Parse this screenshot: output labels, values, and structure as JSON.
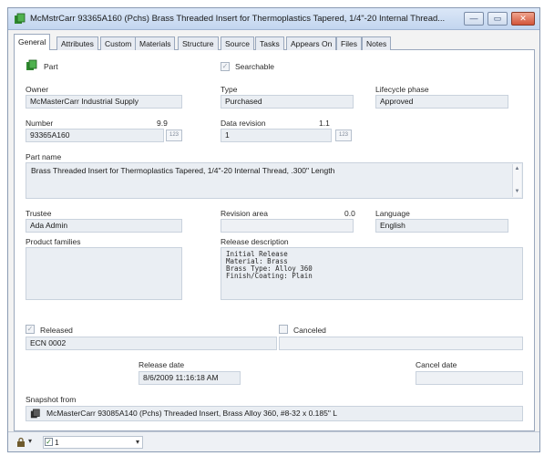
{
  "window": {
    "title": "McMstrCarr 93365A160 (Pchs) Brass Threaded Insert for Thermoplastics Tapered, 1/4\"-20 Internal Thread..."
  },
  "tabs": [
    "General",
    "Attributes",
    "Custom",
    "Materials",
    "Structure",
    "Source",
    "Tasks",
    "Appears On",
    "Files",
    "Notes"
  ],
  "header": {
    "part_label": "Part",
    "searchable_label": "Searchable"
  },
  "fields": {
    "owner_label": "Owner",
    "owner_value": "McMasterCarr Industrial Supply",
    "type_label": "Type",
    "type_value": "Purchased",
    "lifecycle_label": "Lifecycle phase",
    "lifecycle_value": "Approved",
    "number_label": "Number",
    "number_version": "9.9",
    "number_value": "93365A160",
    "datarev_label": "Data revision",
    "datarev_version": "1.1",
    "datarev_value": "1",
    "partname_label": "Part name",
    "partname_value": "Brass Threaded Insert for Thermoplastics Tapered, 1/4\"-20 Internal Thread, .300\" Length",
    "trustee_label": "Trustee",
    "trustee_value": "Ada Admin",
    "revarea_label": "Revision area",
    "revarea_version": "0.0",
    "language_label": "Language",
    "language_value": "English",
    "prodfam_label": "Product families",
    "reldesc_label": "Release description",
    "reldesc_lines": [
      "Initial Release",
      "Material: Brass",
      "Brass Type: Alloy 360",
      "Finish/Coating: Plain"
    ],
    "released_label": "Released",
    "released_value": "ECN 0002",
    "canceled_label": "Canceled",
    "reldate_label": "Release date",
    "reldate_value": "8/6/2009 11:16:18 AM",
    "canceldate_label": "Cancel date",
    "snapshot_label": "Snapshot from",
    "snapshot_value": "McMasterCarr 93085A140 (Pchs) Threaded Insert, Brass Alloy 360, #8-32 x 0.185\" L"
  },
  "statusbar": {
    "combo_value": "1"
  },
  "colors": {
    "title_bg": "#c2d5ef",
    "field_bg": "#eaeef3",
    "part_icon": "#2f8a2f"
  }
}
